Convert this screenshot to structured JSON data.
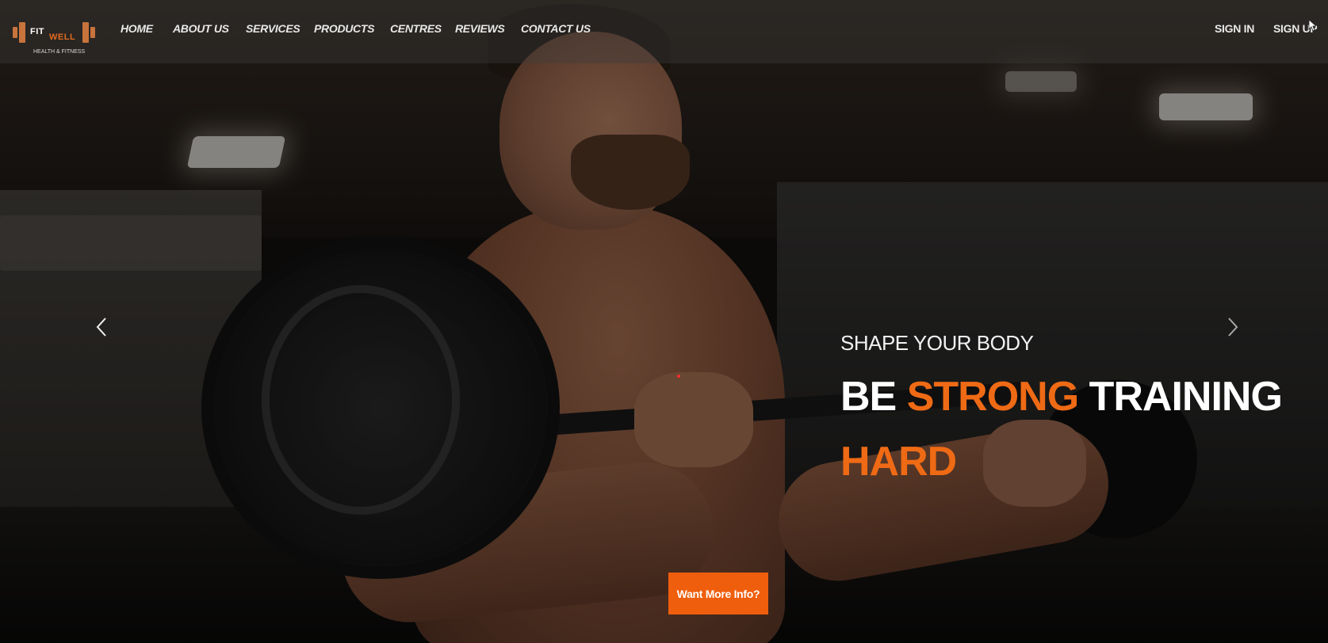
{
  "brand": {
    "name_part1": "FIT",
    "name_part2": "WELL",
    "tagline": "HEALTH & FITNESS",
    "accent_color": "#e06b1f"
  },
  "nav": {
    "links": [
      {
        "label": "HOME"
      },
      {
        "label": "ABOUT US"
      },
      {
        "label": "SERVICES"
      },
      {
        "label": "PRODUCTS"
      },
      {
        "label": "CENTRES"
      },
      {
        "label": "REVIEWS"
      },
      {
        "label": "CONTACT US"
      }
    ],
    "auth": {
      "sign_in": "SIGN IN",
      "sign_up": "SIGN UP"
    }
  },
  "hero": {
    "eyebrow": "SHAPE YOUR BODY",
    "headline_part1": "BE ",
    "headline_accent1": "STRONG",
    "headline_part2": " TRAINING ",
    "headline_accent2": "HARD",
    "cta_label": "Want More Info?",
    "accent_color": "#ef6a15",
    "prev_icon": "chevron-left-icon",
    "next_icon": "chevron-right-icon"
  }
}
